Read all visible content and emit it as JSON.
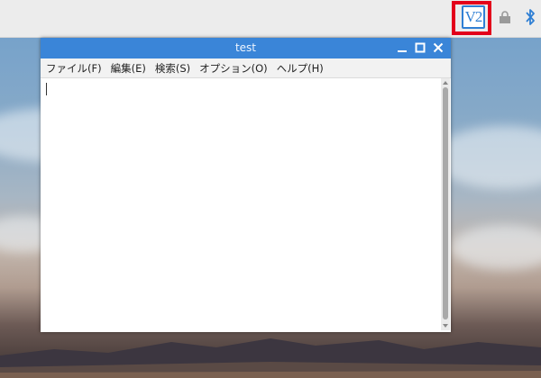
{
  "window": {
    "title": "test"
  },
  "menubar": {
    "items": [
      "ファイル(F)",
      "編集(E)",
      "検索(S)",
      "オプション(O)",
      "ヘルプ(H)"
    ]
  },
  "tray": {
    "vnc_label": "V2",
    "icons": [
      "vnc-server-icon",
      "lock-icon",
      "bluetooth-icon"
    ]
  },
  "colors": {
    "titlebar": "#3a85d8",
    "highlight": "#e3001b",
    "vnc_blue": "#2f7fd4"
  }
}
